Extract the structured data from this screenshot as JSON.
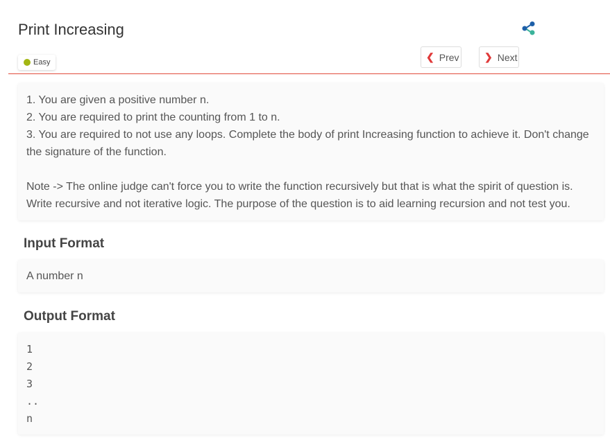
{
  "problem": {
    "title": "Print Increasing",
    "difficulty": "Easy",
    "difficulty_color": "#a3b613",
    "share_icon": "share-icon"
  },
  "nav": {
    "prev_label": "Prev",
    "next_label": "Next"
  },
  "description": {
    "lines": [
      "1. You are given a positive number n.",
      "2. You are required to print the counting from 1 to n.",
      "3. You are required to not use any loops. Complete the body of print Increasing function to achieve it. Don't change the signature of the function."
    ],
    "note": "Note -> The online judge can't force you to write the function recursively but that is what the spirit of question is. Write recursive and not iterative logic. The purpose of the question is to aid learning recursion and not test you."
  },
  "input_format": {
    "heading": "Input Format",
    "text": "A number n"
  },
  "output_format": {
    "heading": "Output Format",
    "lines": [
      "1",
      "2",
      "3",
      "..",
      "n"
    ]
  },
  "colors": {
    "accent": "#e14a3b",
    "share_blue": "#1d5fa8",
    "share_teal": "#3bb39b"
  }
}
